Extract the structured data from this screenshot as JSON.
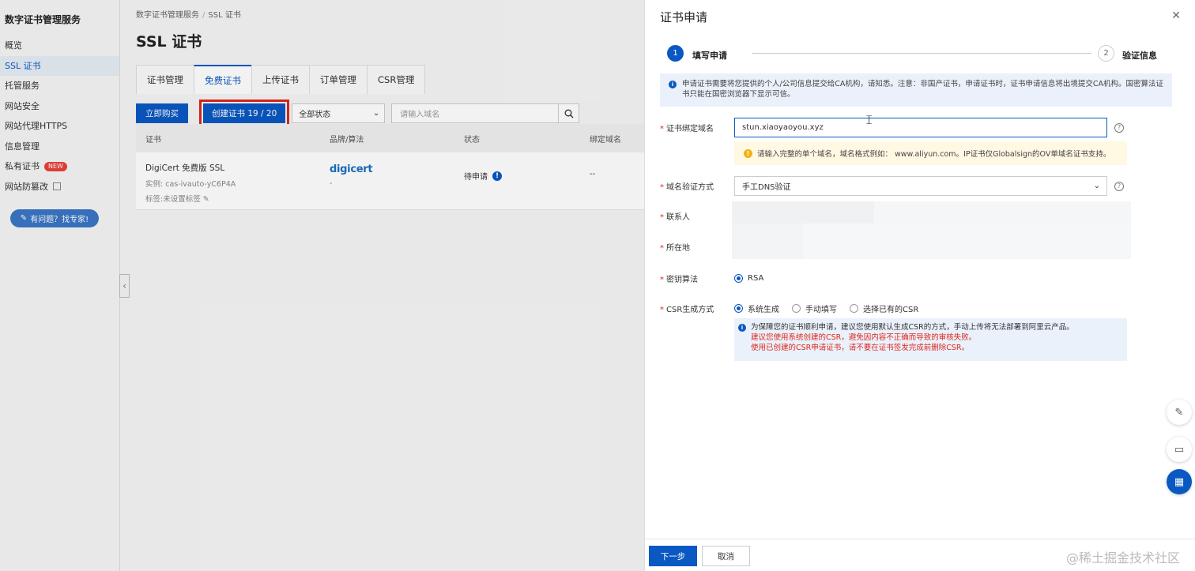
{
  "sidebar": {
    "title": "数字证书管理服务",
    "items": [
      {
        "label": "概览"
      },
      {
        "label": "SSL 证书"
      },
      {
        "label": "托管服务"
      },
      {
        "label": "网站安全"
      },
      {
        "label": "网站代理HTTPS"
      },
      {
        "label": "信息管理"
      },
      {
        "label": "私有证书",
        "badge": "NEW"
      },
      {
        "label": "网站防篡改"
      }
    ],
    "help_button": "有问题？找专家!"
  },
  "main": {
    "breadcrumb": [
      "数字证书管理服务",
      "SSL 证书"
    ],
    "title": "SSL 证书",
    "tabs": [
      "证书管理",
      "免费证书",
      "上传证书",
      "订单管理",
      "CSR管理"
    ],
    "toolbar": {
      "buy_label": "立即购买",
      "create_label": "创建证书 19 / 20",
      "status_select": "全部状态",
      "search_placeholder": "请输入域名"
    },
    "table": {
      "headers": [
        "证书",
        "品牌/算法",
        "状态",
        "绑定域名"
      ],
      "rows": [
        {
          "name": "DigiCert 免费版 SSL",
          "instance": "实例: cas-ivauto-yC6P4A",
          "tags": "标签:未设置标签",
          "brand": "digicert",
          "algo": "-",
          "status": "待申请",
          "domain": "--"
        }
      ]
    }
  },
  "drawer": {
    "title": "证书申请",
    "steps": [
      {
        "num": "1",
        "label": "填写申请"
      },
      {
        "num": "2",
        "label": "验证信息"
      }
    ],
    "notice": "申请证书需要将您提供的个人/公司信息提交给CA机构，请知悉。注意：非国产证书，申请证书时，证书申请信息将出境提交CA机构。国密算法证书只能在国密浏览器下显示可信。",
    "fields": {
      "domain_label": "证书绑定域名",
      "domain_value": "stun.xiaoyaoyou.xyz",
      "domain_warning": "请输入完整的单个域名，域名格式例如： www.aliyun.com。IP证书仅Globalsign的OV单域名证书支持。",
      "verify_label": "域名验证方式",
      "verify_value": "手工DNS验证",
      "contact_label": "联系人",
      "location_label": "所在地",
      "algo_label": "密钥算法",
      "algo_options": [
        "RSA"
      ],
      "csr_label": "CSR生成方式",
      "csr_options": [
        "系统生成",
        "手动填写",
        "选择已有的CSR"
      ],
      "csr_note": "为保障您的证书顺利申请，建议您使用默认生成CSR的方式，手动上传将无法部署到阿里云产品。",
      "csr_warn1": "建议您使用系统创建的CSR，避免因内容不正确而导致的审核失败。",
      "csr_warn2": "使用已创建的CSR申请证书，请不要在证书签发完成前删除CSR。"
    },
    "footer": {
      "next_label": "下一步",
      "cancel_label": "取消"
    },
    "watermark": "@稀土掘金技术社区"
  },
  "colors": {
    "primary": "#0a58c2",
    "danger": "#e0251b",
    "warning": "#f1b216"
  }
}
